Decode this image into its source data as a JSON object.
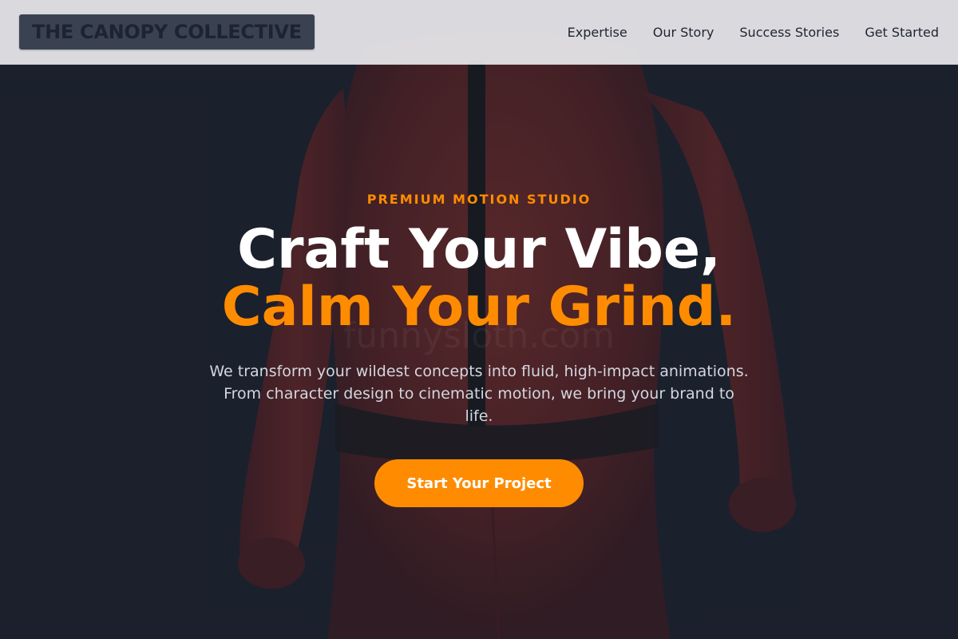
{
  "header": {
    "logo_text": "THE CANOPY COLLECTIVE",
    "nav": [
      {
        "label": "Expertise"
      },
      {
        "label": "Our Story"
      },
      {
        "label": "Success Stories"
      },
      {
        "label": "Get Started"
      }
    ]
  },
  "hero": {
    "eyebrow": "PREMIUM MOTION STUDIO",
    "headline_line1": "Craft Your Vibe,",
    "headline_line2": "Calm Your Grind.",
    "subtext": "We transform your wildest concepts into fluid, high-impact animations. From character design to cinematic motion, we bring your brand to life.",
    "cta_label": "Start Your Project",
    "background_image_watermark": "funnysloth.com"
  },
  "colors": {
    "accent": "#ff8c00",
    "hero_bg": "#1e2230",
    "header_bg": "#e8e8ec",
    "logo_bg": "#3a4252",
    "figure": "#6b2a2a"
  }
}
